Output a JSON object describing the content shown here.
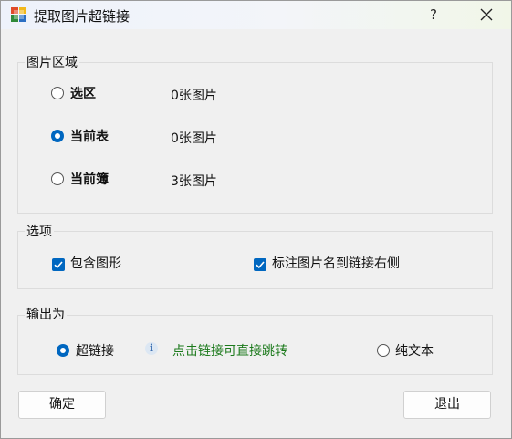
{
  "window": {
    "title": "提取图片超链接"
  },
  "titlebar": {
    "help": "?",
    "close": "✕"
  },
  "region_group": {
    "title": "图片区域",
    "options": [
      {
        "label": "选区",
        "count": "0张图片",
        "selected": false
      },
      {
        "label": "当前表",
        "count": "0张图片",
        "selected": true
      },
      {
        "label": "当前簿",
        "count": "3张图片",
        "selected": false
      }
    ]
  },
  "options_group": {
    "title": "选项",
    "include_shapes": {
      "label": "包含图形",
      "checked": true
    },
    "mark_name": {
      "label": "标注图片名到链接右侧",
      "checked": true
    }
  },
  "output_group": {
    "title": "输出为",
    "hyperlink": {
      "label": "超链接",
      "selected": true
    },
    "info_text": "点击链接可直接跳转",
    "plain_text": {
      "label": "纯文本",
      "selected": false
    }
  },
  "buttons": {
    "ok": "确定",
    "exit": "退出"
  },
  "colors": {
    "accent": "#0067c0",
    "info_green": "#1c7a1c"
  }
}
